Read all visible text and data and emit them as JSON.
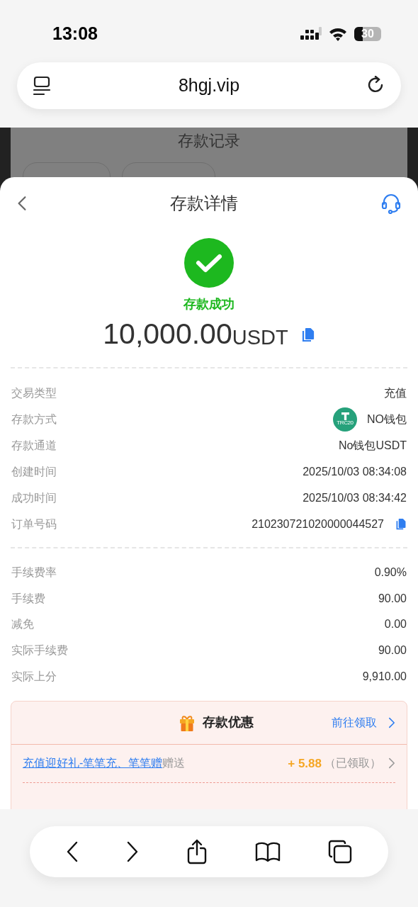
{
  "status_bar": {
    "time": "13:08",
    "battery": "30"
  },
  "browser": {
    "url": "8hgj.vip"
  },
  "background_page": {
    "title": "存款记录"
  },
  "sheet": {
    "title": "存款详情",
    "status": "存款成功",
    "amount": "10,000.00",
    "currency": "USDT"
  },
  "details": [
    {
      "kind": "text",
      "label": "交易类型",
      "value": "充值"
    },
    {
      "kind": "method",
      "label": "存款方式",
      "value": "NO钱包",
      "badge": "TRC20"
    },
    {
      "kind": "text",
      "label": "存款通道",
      "value": "No钱包USDT"
    },
    {
      "kind": "text",
      "label": "创建时间",
      "value": "2025/10/03 08:34:08"
    },
    {
      "kind": "text",
      "label": "成功时间",
      "value": "2025/10/03 08:34:42"
    },
    {
      "kind": "copy",
      "label": "订单号码",
      "value": "210230721020000044527"
    }
  ],
  "fees": [
    {
      "label": "手续费率",
      "value": "0.90%"
    },
    {
      "label": "手续费",
      "value": "90.00"
    },
    {
      "label": "减免",
      "value": "0.00"
    },
    {
      "label": "实际手续费",
      "value": "90.00"
    },
    {
      "label": "实际上分",
      "value": "9,910.00"
    }
  ],
  "promo": {
    "title": "存款优惠",
    "action": "前往领取",
    "items": [
      {
        "link": "充值迎好礼-笔笔充、笔笔赠",
        "suffix": "赠送",
        "amount": "+ 5.88",
        "status": "（已领取）"
      }
    ]
  }
}
